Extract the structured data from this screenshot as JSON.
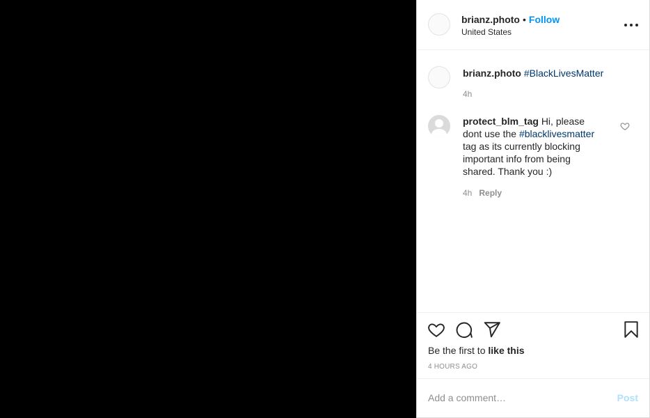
{
  "header": {
    "username": "brianz.photo",
    "separator": "•",
    "follow_label": "Follow",
    "location": "United States"
  },
  "comments": [
    {
      "username": "brianz.photo",
      "hashtag": "#BlackLivesMatter",
      "time": "4h"
    },
    {
      "username": "protect_blm_tag",
      "text_before": "Hi, please dont use the",
      "hashtag": "#blacklivesmatter",
      "text_after": "tag as its currently blocking important info from being shared. Thank you :)",
      "time": "4h",
      "reply_label": "Reply"
    }
  ],
  "actions": {
    "likes_prefix": "Be the first to",
    "likes_bold": "like this",
    "timestamp": "4 HOURS AGO"
  },
  "add_comment": {
    "placeholder": "Add a comment…",
    "post_label": "Post"
  },
  "colors": {
    "link_blue": "#0095f6",
    "hashtag": "#00376b",
    "post_disabled": "#b2dffc",
    "media_bg": "#000000"
  }
}
